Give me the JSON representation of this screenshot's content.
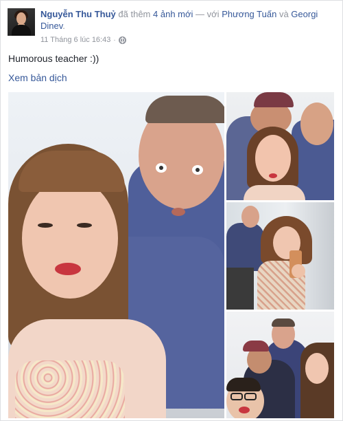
{
  "post": {
    "author": "Nguyễn Thu Thuỷ",
    "action_text": "đã thêm",
    "photo_count_link": "4 ảnh mới",
    "with_text": "— với",
    "tag1": "Phương Tuấn",
    "and_text": "và",
    "tag2": "Georgi Dinev",
    "period": ".",
    "timestamp": "11 Tháng 6 lúc 16:43",
    "separator": "·",
    "privacy_icon": "globe-icon",
    "status_text": "Humorous teacher :))",
    "translate_link": "Xem bản dịch"
  },
  "photos": [
    {
      "name": "selfie with teacher"
    },
    {
      "name": "group photo with cap"
    },
    {
      "name": "mirror selfie"
    },
    {
      "name": "group selfie"
    }
  ],
  "colors": {
    "link": "#365899",
    "meta": "#90949c",
    "text": "#1d2129"
  }
}
